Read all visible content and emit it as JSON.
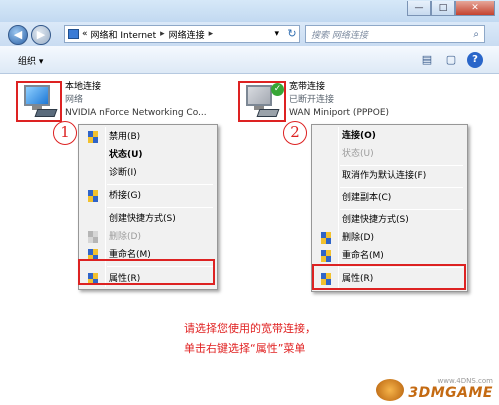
{
  "window": {
    "minimize": "—",
    "maximize": "□",
    "close": "✕"
  },
  "address": {
    "back": "◀",
    "forward": "▶",
    "prefix": "«",
    "crumbs": [
      "网络和 Internet",
      "网络连接"
    ],
    "separator": "▸",
    "dropdown": "▾",
    "refresh": "↻"
  },
  "search": {
    "placeholder": "搜索 网络连接",
    "icon": "search-icon"
  },
  "toolbar": {
    "organize": "组织 ▾",
    "view_icon": "▤",
    "pane_icon": "▢",
    "help": "?"
  },
  "connections": [
    {
      "name": "本地连接",
      "status": "网络",
      "device": "NVIDIA nForce Networking Co...",
      "step": "1"
    },
    {
      "name": "宽带连接",
      "status": "已断开连接",
      "device": "WAN Miniport (PPPOE)",
      "step": "2"
    }
  ],
  "menu1": [
    {
      "label": "禁用(B)",
      "shield": true
    },
    {
      "label": "状态(U)",
      "bold": true
    },
    {
      "label": "诊断(I)"
    },
    {
      "label": "桥接(G)",
      "shield": true
    },
    {
      "label": "创建快捷方式(S)"
    },
    {
      "label": "删除(D)",
      "shield": true,
      "disabled": true
    },
    {
      "label": "重命名(M)",
      "shield": true
    },
    {
      "label": "属性(R)",
      "shield": true
    }
  ],
  "menu2": [
    {
      "label": "连接(O)",
      "bold": true
    },
    {
      "label": "状态(U)",
      "disabled": true
    },
    {
      "label": "取消作为默认连接(F)"
    },
    {
      "label": "创建副本(C)"
    },
    {
      "label": "创建快捷方式(S)"
    },
    {
      "label": "删除(D)",
      "shield": true
    },
    {
      "label": "重命名(M)",
      "shield": true
    },
    {
      "label": "属性(R)",
      "shield": true
    }
  ],
  "instruction": {
    "line1": "请选择您使用的宽带连接，",
    "line2": "单击右键选择“属性”菜单"
  },
  "watermark": {
    "site": "www.4DNS.com",
    "brand": "3DMGAME"
  },
  "colors": {
    "highlight": "#dd2222",
    "instruction": "#e02020"
  }
}
